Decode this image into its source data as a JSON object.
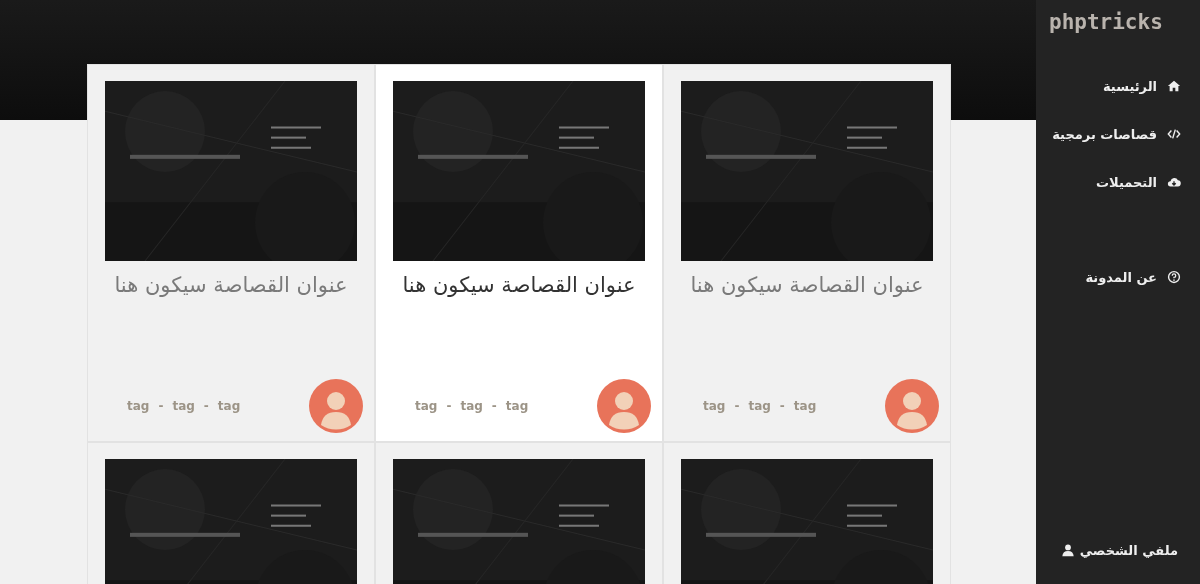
{
  "sidebar": {
    "logo": "phptricks",
    "items": [
      {
        "label": "الرئيسية"
      },
      {
        "label": "قصاصات برمجية"
      },
      {
        "label": "التحميلات"
      },
      {
        "label": "عن المدونة"
      }
    ],
    "profile": {
      "label": "ملفي الشخصي"
    }
  },
  "posts": [
    {
      "title": "عنوان القصاصة سيكون هنا",
      "highlighted": false,
      "tags": [
        "tag",
        "tag",
        "tag"
      ],
      "separator": "-"
    },
    {
      "title": "عنوان القصاصة سيكون هنا",
      "highlighted": true,
      "tags": [
        "tag",
        "tag",
        "tag"
      ],
      "separator": "-"
    },
    {
      "title": "عنوان القصاصة سيكون هنا",
      "highlighted": false,
      "tags": [
        "tag",
        "tag",
        "tag"
      ],
      "separator": "-"
    },
    {
      "kind": "picture",
      "highlighted": false
    },
    {
      "kind": "picture",
      "highlighted": false
    },
    {
      "kind": "picture",
      "highlighted": false
    }
  ]
}
